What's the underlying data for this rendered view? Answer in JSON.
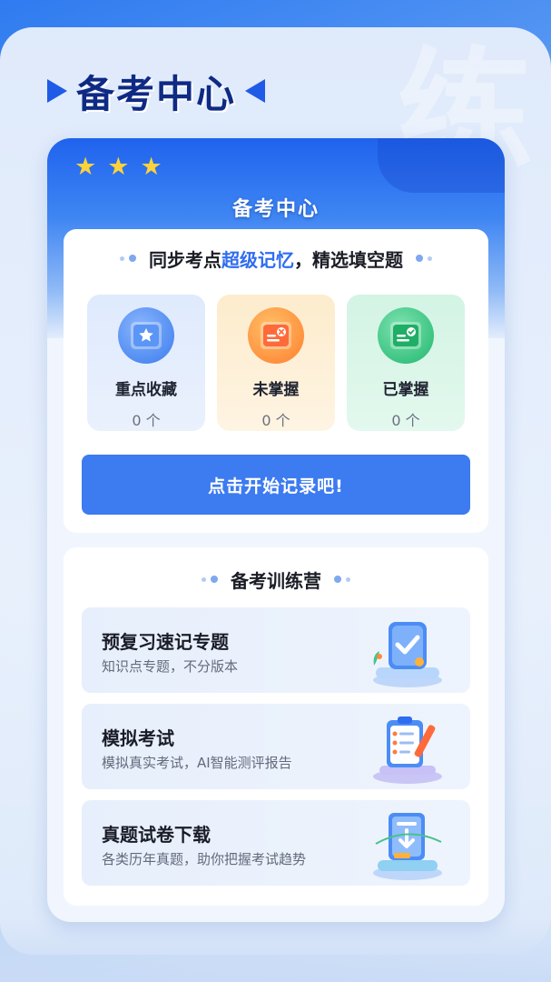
{
  "page_title": "备考中心",
  "card": {
    "title": "备考中心",
    "stars": [
      "★",
      "★",
      "★"
    ]
  },
  "sync": {
    "heading_prefix": "同步考点",
    "heading_accent": "超级记忆",
    "heading_suffix": "，精选填空题",
    "tiles": [
      {
        "label": "重点收藏",
        "count": "0 个",
        "icon": "star-book-icon"
      },
      {
        "label": "未掌握",
        "count": "0 个",
        "icon": "cross-book-icon"
      },
      {
        "label": "已掌握",
        "count": "0 个",
        "icon": "check-book-icon"
      }
    ],
    "button": "点击开始记录吧!"
  },
  "camp": {
    "heading": "备考训练营",
    "items": [
      {
        "title": "预复习速记专题",
        "subtitle": "知识点专题，不分版本",
        "icon": "check-card-icon"
      },
      {
        "title": "模拟考试",
        "subtitle": "模拟真实考试，AI智能测评报告",
        "icon": "clipboard-pencil-icon"
      },
      {
        "title": "真题试卷下载",
        "subtitle": "各类历年真题，助你把握考试趋势",
        "icon": "download-doc-icon"
      }
    ]
  },
  "colors": {
    "primary": "#3c7bf0",
    "title_dark": "#0e2a84",
    "accent_text": "#2f6df0",
    "star": "#ffd23a"
  }
}
